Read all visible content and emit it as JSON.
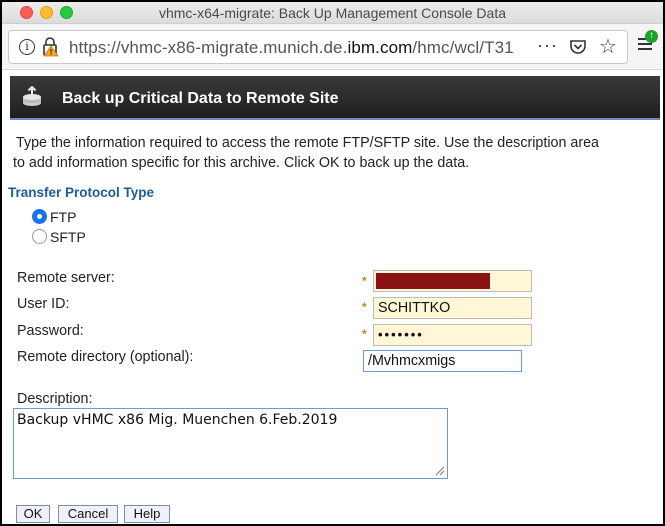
{
  "window": {
    "title": "vhmc-x64-migrate: Back Up Management Console Data"
  },
  "browser": {
    "url_prefix": "https://vhmc-x86-migrate.munich.de.",
    "url_domain": "ibm.com",
    "url_suffix": "/hmc/wcl/T31",
    "more_icon": "···",
    "update_badge": "↑"
  },
  "dialog": {
    "title": "Back up Critical Data to Remote Site",
    "intro_line1": "Type the information required to access the remote FTP/SFTP site. Use the description area",
    "intro_line2": "to add information specific for this archive. Click OK to back up the data.",
    "section_title": "Transfer Protocol Type",
    "protocols": [
      {
        "label": "FTP",
        "selected": true
      },
      {
        "label": "SFTP",
        "selected": false
      }
    ],
    "fields": {
      "remote_server_label": "Remote server:",
      "user_id_label": "User ID:",
      "user_id_value": "SCHITTKO",
      "password_label": "Password:",
      "password_value": "•••••••",
      "remote_dir_label": "Remote directory (optional):",
      "remote_dir_value": "/Mvhmcxmigs",
      "required_marker": "*"
    },
    "description_label": "Description:",
    "description_value": "Backup vHMC x86 Mig. Muenchen 6.Feb.2019",
    "buttons": {
      "ok": "OK",
      "cancel": "Cancel",
      "help": "Help"
    }
  },
  "colors": {
    "section_title": "#1d5c9c",
    "required_bg": "#fff7d6",
    "redaction": "#8b1212",
    "radio_selected": "#1a73e8"
  }
}
